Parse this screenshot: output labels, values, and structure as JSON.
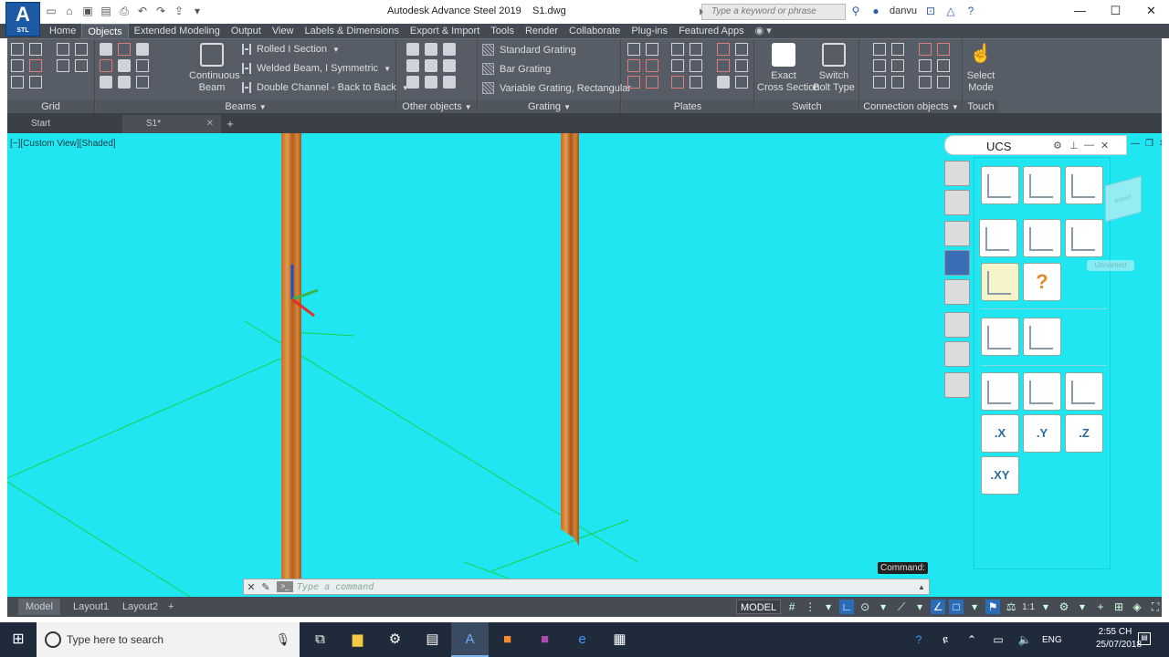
{
  "title_bar": {
    "logo_letter": "A",
    "logo_sub": "STL",
    "title": "Autodesk Advance Steel 2019",
    "file": "S1.dwg",
    "search_placeholder": "Type a keyword or phrase",
    "user": "danvu"
  },
  "tabs": [
    "Home",
    "Objects",
    "Extended Modeling",
    "Output",
    "View",
    "Labels & Dimensions",
    "Export & Import",
    "Tools",
    "Render",
    "Collaborate",
    "Plug-ins",
    "Featured Apps"
  ],
  "active_tab": "Objects",
  "ribbon": {
    "grid_title": "Grid",
    "beams_title": "Beams",
    "continuous_beam": "Continuous\nBeam",
    "beam_items": [
      "Rolled I Section",
      "Welded Beam, I Symmetric",
      "Double Channel - Back to Back"
    ],
    "other_objects_title": "Other objects",
    "grating_title": "Grating",
    "grating_items": [
      "Standard Grating",
      "Bar Grating",
      "Variable Grating, Rectangular"
    ],
    "plates_title": "Plates",
    "exact_cross": "Exact\nCross Section",
    "switch_bolt": "Switch\nBolt Type",
    "switch_title": "Switch",
    "connection_title": "Connection objects",
    "select_mode": "Select\nMode",
    "touch_title": "Touch"
  },
  "file_tabs": {
    "start": "Start",
    "current": "S1*"
  },
  "viewport": {
    "label": "[−][Custom View][Shaded]",
    "command_label": "Command:",
    "command_placeholder": "Type a command",
    "background": "#20e6f2"
  },
  "ucs_palette": {
    "title": "UCS",
    "axis_buttons": [
      ".X",
      ".Y",
      ".Z"
    ],
    "xy_button": ".XY",
    "unnamed": "Unnamed",
    "viewcube_label": "RIGHT"
  },
  "layout_tabs": [
    "Model",
    "Layout1",
    "Layout2"
  ],
  "status": {
    "model": "MODEL",
    "scale": "1:1"
  },
  "taskbar": {
    "search_placeholder": "Type here to search",
    "lang": "ENG",
    "time": "2:55 CH",
    "date": "25/07/2018"
  }
}
